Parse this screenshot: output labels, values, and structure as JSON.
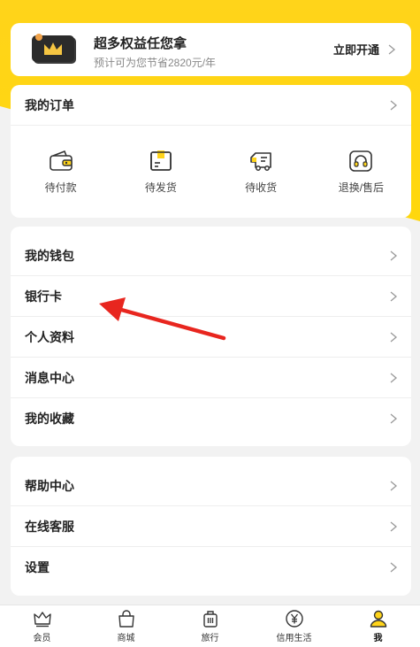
{
  "vip": {
    "title": "超多权益任您拿",
    "subtitle": "预计可为您节省2820元/年",
    "action": "立即开通"
  },
  "orders": {
    "title": "我的订单",
    "items": [
      {
        "label": "待付款",
        "icon": "wallet-icon"
      },
      {
        "label": "待发货",
        "icon": "box-icon"
      },
      {
        "label": "待收货",
        "icon": "truck-icon"
      },
      {
        "label": "退换/售后",
        "icon": "headset-icon"
      }
    ]
  },
  "menu1": {
    "items": [
      {
        "label": "我的钱包"
      },
      {
        "label": "银行卡"
      },
      {
        "label": "个人资料"
      },
      {
        "label": "消息中心"
      },
      {
        "label": "我的收藏"
      }
    ]
  },
  "menu2": {
    "items": [
      {
        "label": "帮助中心"
      },
      {
        "label": "在线客服"
      },
      {
        "label": "设置"
      }
    ]
  },
  "tabbar": {
    "items": [
      {
        "label": "会员",
        "icon": "crown-icon"
      },
      {
        "label": "商城",
        "icon": "shopping-bag-icon"
      },
      {
        "label": "旅行",
        "icon": "luggage-icon"
      },
      {
        "label": "信用生活",
        "icon": "yuan-coin-icon"
      },
      {
        "label": "我",
        "icon": "user-icon"
      }
    ],
    "active": "我"
  },
  "colors": {
    "accent": "#ffd41a",
    "annotation_arrow": "#e8261f"
  }
}
